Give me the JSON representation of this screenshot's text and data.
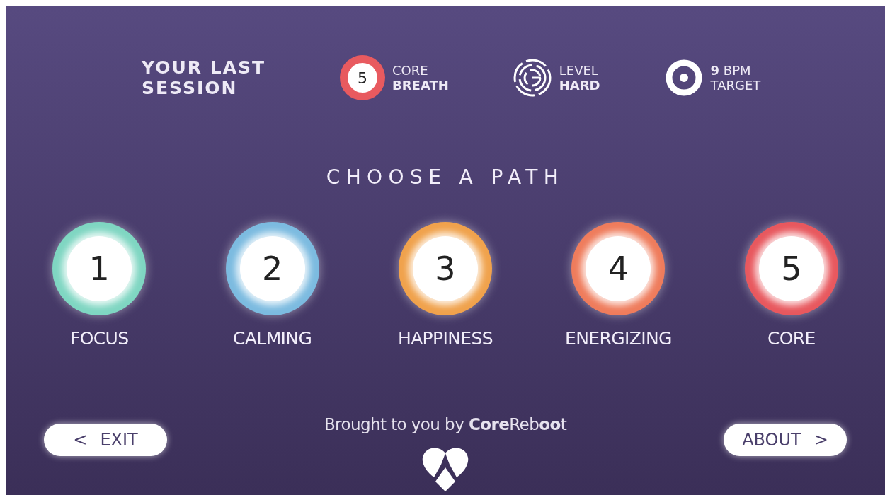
{
  "last_session": {
    "title_lines": [
      "YOUR LAST",
      "SESSION"
    ],
    "items": [
      {
        "kind": "path",
        "number": "5",
        "color": "#e85a5f",
        "line1": "CORE",
        "line2": "BREATH"
      },
      {
        "kind": "level",
        "line1": "LEVEL",
        "line2": "HARD"
      },
      {
        "kind": "target",
        "line1": "9",
        "line1_rest": "BPM",
        "line2": "TARGET"
      }
    ]
  },
  "heading": "CHOOSE A PATH",
  "paths": [
    {
      "number": "1",
      "label": "FOCUS",
      "color": "#7fd6c2"
    },
    {
      "number": "2",
      "label": "CALMING",
      "color": "#7cbbe0"
    },
    {
      "number": "3",
      "label": "HAPPINESS",
      "color": "#f0a24c"
    },
    {
      "number": "4",
      "label": "ENERGIZING",
      "color": "#ef7c5c"
    },
    {
      "number": "5",
      "label": "CORE",
      "color": "#e8585e"
    }
  ],
  "credit": "Brought to you by **Core**Reb**oo**t",
  "buttons": [
    {
      "kind": "back",
      "label": "EXIT",
      "icon": "<"
    },
    {
      "kind": "forward",
      "label": "ABOUT",
      "icon": ">"
    }
  ]
}
